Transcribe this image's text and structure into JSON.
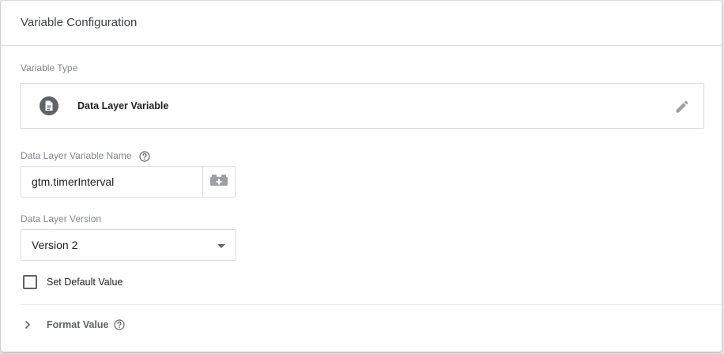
{
  "card": {
    "title": "Variable Configuration"
  },
  "variable_type": {
    "label": "Variable Type",
    "name": "Data Layer Variable",
    "icon": "document-icon"
  },
  "variable_name": {
    "label": "Data Layer Variable Name",
    "value": "gtm.timerInterval"
  },
  "version": {
    "label": "Data Layer Version",
    "selected": "Version 2"
  },
  "default_value": {
    "label": "Set Default Value",
    "checked": false
  },
  "format_value": {
    "label": "Format Value"
  },
  "colors": {
    "icon_gray": "#5f6368",
    "border": "#dadce0",
    "label_gray": "#80868b"
  }
}
